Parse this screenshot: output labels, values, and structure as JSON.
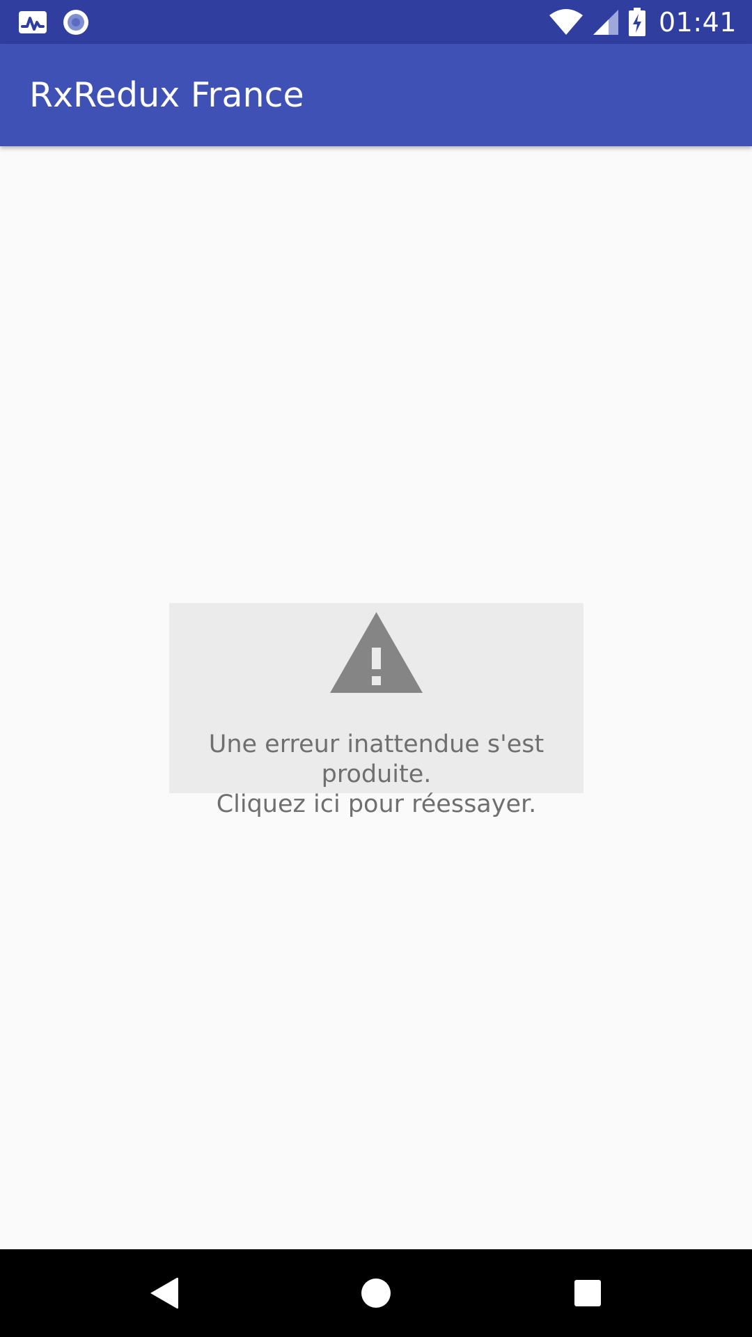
{
  "status_bar": {
    "time": "01:41",
    "icons": [
      "activity-monitor-icon",
      "record-icon",
      "wifi-icon",
      "cellular-signal-icon",
      "battery-charging-icon"
    ]
  },
  "app_bar": {
    "title": "RxRedux France"
  },
  "error": {
    "icon": "warning-icon",
    "message": "Une erreur inattendue s'est produite.\nCliquez ici pour réessayer."
  },
  "nav_bar": {
    "icons": [
      "back-icon",
      "home-icon",
      "recents-icon"
    ]
  },
  "colors": {
    "status_bar": "#303f9f",
    "app_bar": "#3f51b5",
    "background": "#fafafa",
    "error_panel": "#ebebeb",
    "error_text": "#6f6f6f",
    "warning_icon": "#858585",
    "nav_bar": "#000000"
  }
}
